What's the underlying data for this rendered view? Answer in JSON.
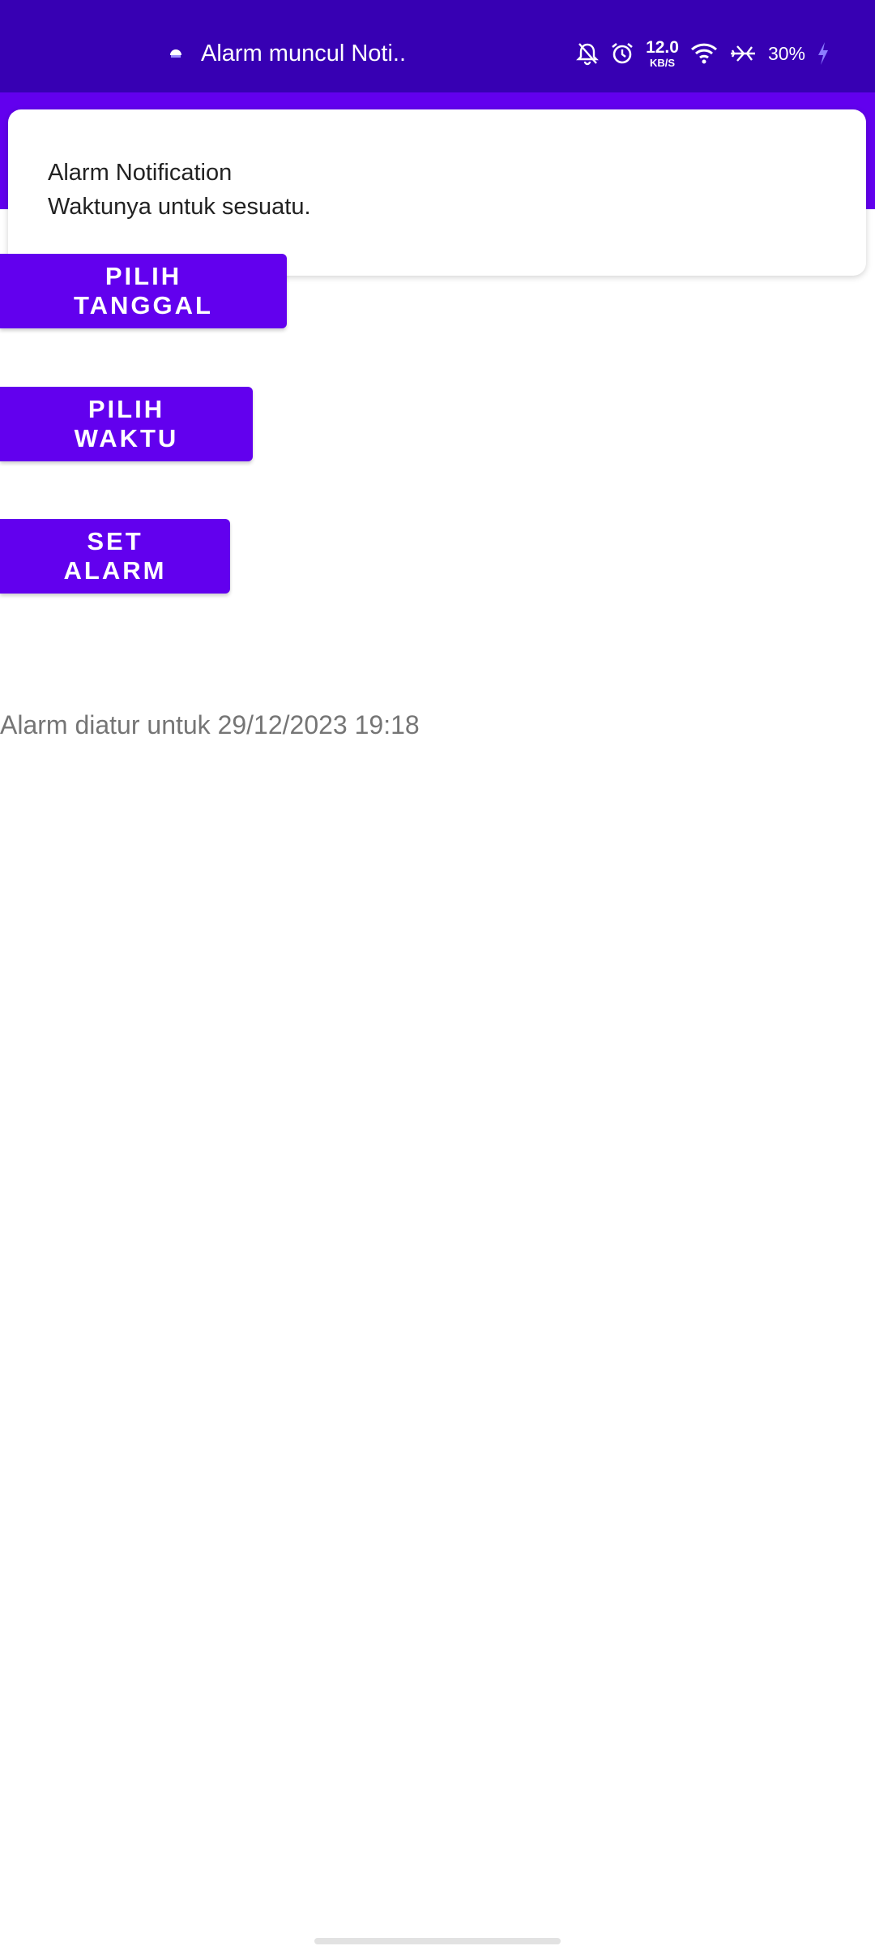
{
  "status_bar": {
    "notification_title": "Alarm muncul Noti..",
    "net_speed_value": "12.0",
    "net_speed_unit": "KB/S",
    "battery_percent": "30%",
    "icons": [
      "app-notification-icon",
      "bell-off-icon",
      "alarm-clock-icon",
      "wifi-icon",
      "airplane-mode-icon",
      "charging-bolt-icon"
    ]
  },
  "notification": {
    "title": "Alarm Notification",
    "text": "Waktunya untuk sesuatu."
  },
  "buttons": {
    "pick_date": "PILIH TANGGAL",
    "pick_time": "PILIH WAKTU",
    "set_alarm": "SET ALARM"
  },
  "alarm_status": "Alarm diatur untuk 29/12/2023 19:18",
  "colors": {
    "status_bar": "#3700b3",
    "primary": "#6200ee",
    "button_text": "#ffffff",
    "status_text": "#757575"
  }
}
